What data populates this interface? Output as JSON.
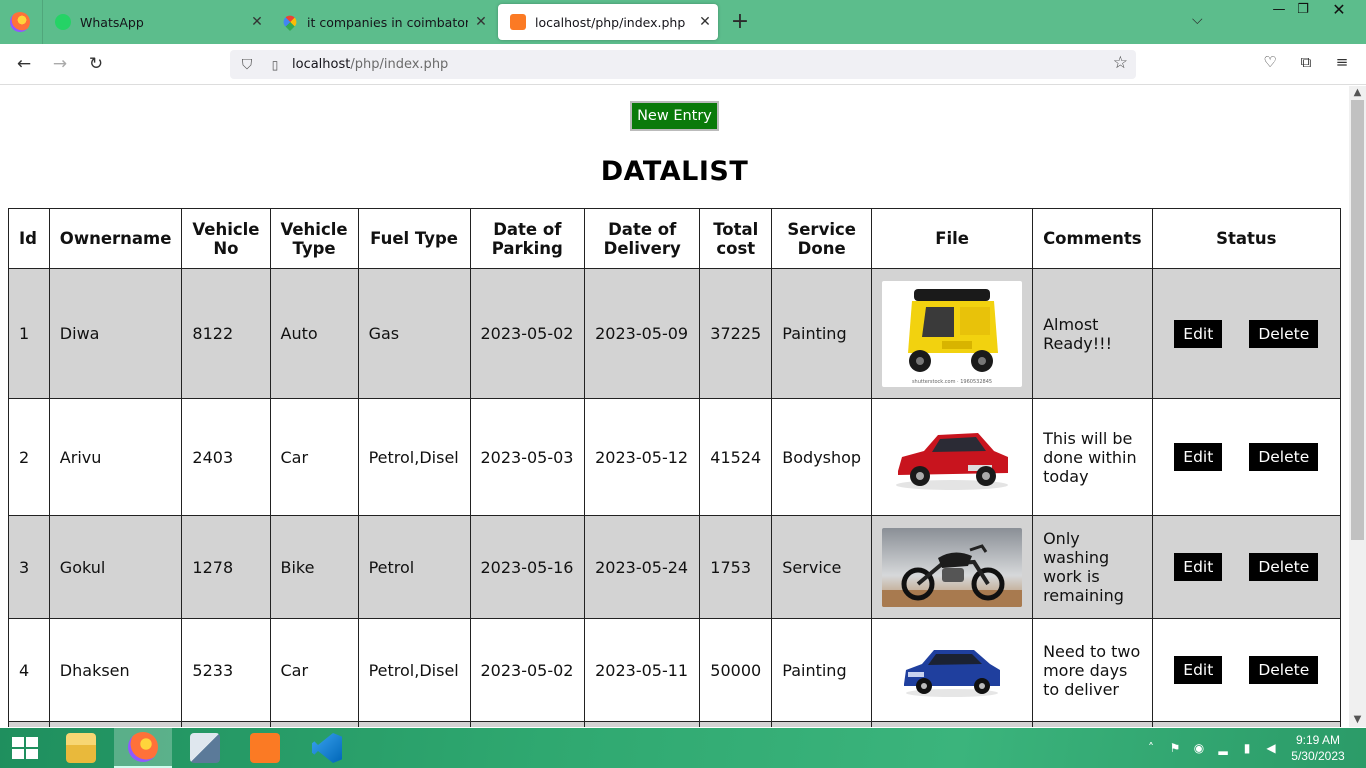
{
  "browser": {
    "tabs": [
      {
        "title": "WhatsApp",
        "icon": "whatsapp-icon",
        "active": false
      },
      {
        "title": "it companies in coimbatore for",
        "icon": "google-maps-icon",
        "active": false
      },
      {
        "title": "localhost/php/index.php",
        "icon": "xampp-icon",
        "active": true
      }
    ],
    "new_tab_label": "+",
    "url": {
      "host": "localhost",
      "path": "/php/index.php"
    }
  },
  "page": {
    "new_entry_label": "New Entry",
    "heading": "DATALIST",
    "table": {
      "columns": [
        "Id",
        "Ownername",
        "Vehicle No",
        "Vehicle Type",
        "Fuel Type",
        "Date of Parking",
        "Date of Delivery",
        "Total cost",
        "Service Done",
        "File",
        "Comments",
        "Status"
      ],
      "rows": [
        {
          "id": "1",
          "owner": "Diwa",
          "vehicle_no": "8122",
          "vehicle_type": "Auto",
          "fuel": "Gas",
          "parking": "2023-05-02",
          "delivery": "2023-05-09",
          "cost": "37225",
          "service": "Painting",
          "file_image": "auto-rickshaw-image",
          "image_caption": "shutterstock.com · 1960532845",
          "comments": "Almost Ready!!!",
          "edit": "Edit",
          "delete": "Delete"
        },
        {
          "id": "2",
          "owner": "Arivu",
          "vehicle_no": "2403",
          "vehicle_type": "Car",
          "fuel": "Petrol,Disel",
          "parking": "2023-05-03",
          "delivery": "2023-05-12",
          "cost": "41524",
          "service": "Bodyshop",
          "file_image": "red-hatchback-car-image",
          "comments": "This will be done within today",
          "edit": "Edit",
          "delete": "Delete"
        },
        {
          "id": "3",
          "owner": "Gokul",
          "vehicle_no": "1278",
          "vehicle_type": "Bike",
          "fuel": "Petrol",
          "parking": "2023-05-16",
          "delivery": "2023-05-24",
          "cost": "1753",
          "service": "Service",
          "file_image": "motorcycle-image",
          "comments": "Only washing work is remaining",
          "edit": "Edit",
          "delete": "Delete"
        },
        {
          "id": "4",
          "owner": "Dhaksen",
          "vehicle_no": "5233",
          "vehicle_type": "Car",
          "fuel": "Petrol,Disel",
          "parking": "2023-05-02",
          "delivery": "2023-05-11",
          "cost": "50000",
          "service": "Painting",
          "file_image": "blue-suv-car-image",
          "comments": "Need to two more days to deliver",
          "edit": "Edit",
          "delete": "Delete"
        }
      ]
    }
  },
  "taskbar": {
    "apps": [
      "file-explorer-icon",
      "firefox-icon",
      "network-manager-icon",
      "xampp-icon",
      "vscode-icon"
    ],
    "clock": {
      "time": "9:19 AM",
      "date": "5/30/2023"
    }
  },
  "colors": {
    "tabbar": "#5cbd8c",
    "new_entry_button": "#0a7a0a",
    "odd_row": "#d3d3d3",
    "action_button": "#000000"
  }
}
